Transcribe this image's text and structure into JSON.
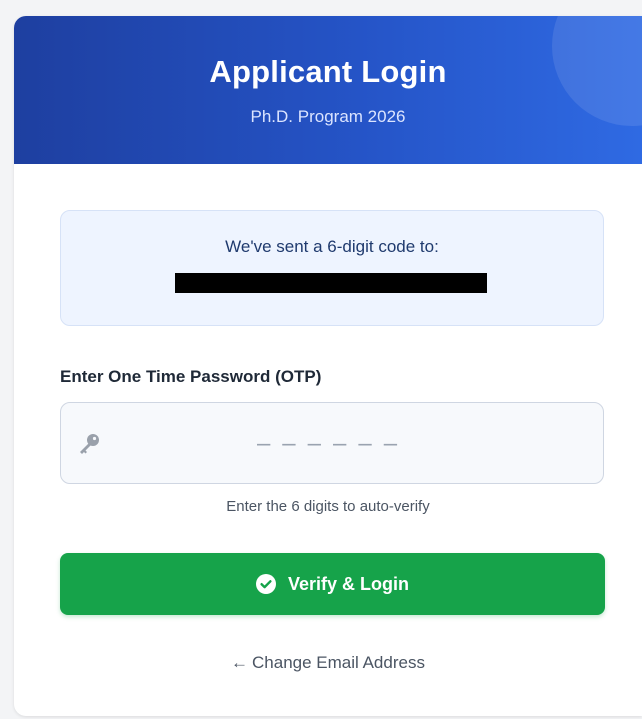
{
  "header": {
    "title": "Applicant Login",
    "subtitle": "Ph.D. Program 2026"
  },
  "notice": {
    "text": "We've sent a 6-digit code to:"
  },
  "otp": {
    "label": "Enter One Time Password (OTP)",
    "placeholder": "––––––",
    "value": "",
    "hint": "Enter the 6 digits to auto-verify"
  },
  "actions": {
    "verify_label": "Verify & Login",
    "change_email_label": "Change Email Address",
    "change_email_arrow": "←"
  },
  "icons": {
    "key": "key-icon",
    "verify": "check-circle-icon",
    "back": "arrow-left-icon"
  },
  "colors": {
    "header_start": "#1e3fa0",
    "header_end": "#2f6ae3",
    "primary_action": "#16a34a",
    "notice_background": "#eef4ff"
  }
}
